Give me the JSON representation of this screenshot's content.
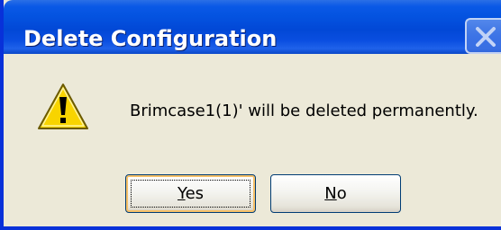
{
  "dialog": {
    "title": "Delete Configuration",
    "message": "Brimcase1(1)' will be deleted permanently.",
    "icon": "warning-icon",
    "buttons": {
      "yes_label": "Yes",
      "no_label": "No"
    },
    "close_icon": "close-icon"
  },
  "colors": {
    "titlebar": "#0453e0",
    "face": "#ece9d8",
    "warning_fill": "#f8d400",
    "button_border": "#003c74",
    "focus_highlight": "#f6c067"
  }
}
